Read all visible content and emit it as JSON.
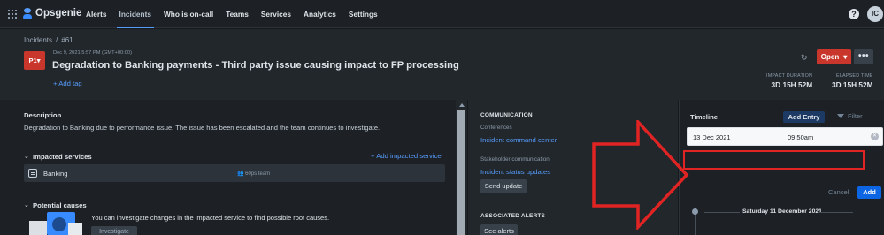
{
  "nav": {
    "brand": "Opsgenie",
    "items": [
      "Alerts",
      "Incidents",
      "Who is on-call",
      "Teams",
      "Services",
      "Analytics",
      "Settings"
    ],
    "active_index": 1,
    "help_glyph": "?",
    "avatar_initials": "IC"
  },
  "header": {
    "breadcrumb_root": "Incidents",
    "breadcrumb_sep": "/",
    "breadcrumb_id": "#61",
    "priority": "P1",
    "datetime": "Dec 9, 2021 5:57 PM (GMT+00:00)",
    "title": "Degradation to Banking payments - Third party issue causing impact to FP processing",
    "add_tag": "+ Add tag",
    "status_label": "Open",
    "more_glyph": "•••",
    "impact_duration_label": "IMPACT DURATION",
    "impact_duration_value": "3D 15H 52M",
    "elapsed_time_label": "ELAPSED TIME",
    "elapsed_time_value": "3D 15H 52M"
  },
  "details": {
    "description_heading": "Description",
    "description_text": "Degradation to Banking due to performance issue. The issue has been escalated and the team continues to investigate.",
    "impacted_services_heading": "Impacted services",
    "add_impacted_service": "+ Add impacted service",
    "service_name": "Banking",
    "service_team": "60ps team",
    "potential_causes_heading": "Potential causes",
    "causes_text": "You can investigate changes in the impacted service to find possible root causes.",
    "investigate_button": "Investigate"
  },
  "communication": {
    "heading": "COMMUNICATION",
    "conferences_label": "Conferences",
    "command_center_link": "Incident command center",
    "stakeholder_label": "Stakeholder communication",
    "status_updates_link": "Incident status updates",
    "send_update_button": "Send update",
    "associated_alerts_heading": "ASSOCIATED ALERTS",
    "see_alerts_button": "See alerts"
  },
  "timeline": {
    "title": "Timeline",
    "add_entry_button": "Add Entry",
    "filter_label": "Filter",
    "date_value": "13 Dec 2021",
    "time_value": "09:50am",
    "cancel_button": "Cancel",
    "add_button": "Add",
    "day_separator": "Saturday 11 December 2021"
  },
  "icons": {
    "apps": "grid-icon",
    "brand": "opsgenie-logo-icon",
    "help": "help-icon",
    "refresh": "refresh-icon",
    "service": "service-icon",
    "team": "team-icon",
    "filter": "filter-icon",
    "clear": "clear-icon"
  },
  "colors": {
    "accent": "#579dff",
    "priority_red": "#c9372c",
    "annotation_red": "#e02424",
    "primary_button": "#0c66e4"
  }
}
